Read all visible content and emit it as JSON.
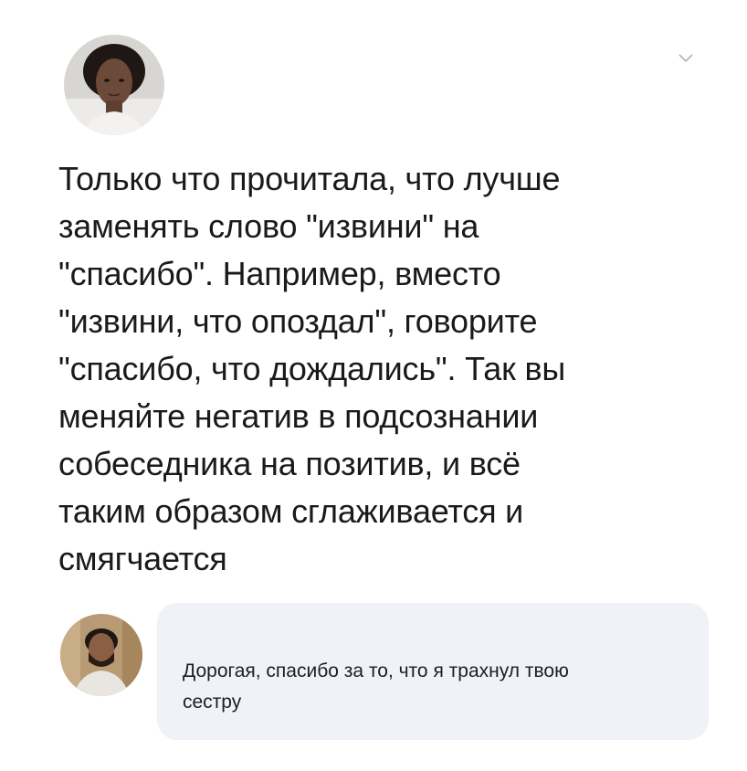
{
  "post": {
    "author_avatar": "woman-avatar",
    "menu_icon": "chevron-down-icon",
    "text_lines": [
      "Только что прочитала, что лучше",
      "заменять слово \"извини\" на",
      "\"спасибо\". Например, вместо",
      "\"извини, что опоздал\", говорите",
      "\"спасибо, что дождались\". Так вы",
      "меняйте негатив в подсознании",
      "собеседника на позитив, и всё",
      "таким образом сглаживается и",
      "смягчается"
    ]
  },
  "reply": {
    "author_avatar": "man-avatar",
    "text_lines": [
      "Дорогая, спасибо за то, что я трахнул твою",
      "сестру"
    ]
  },
  "colors": {
    "bubble": "#f0f2f7",
    "text": "#1a1a1a"
  }
}
